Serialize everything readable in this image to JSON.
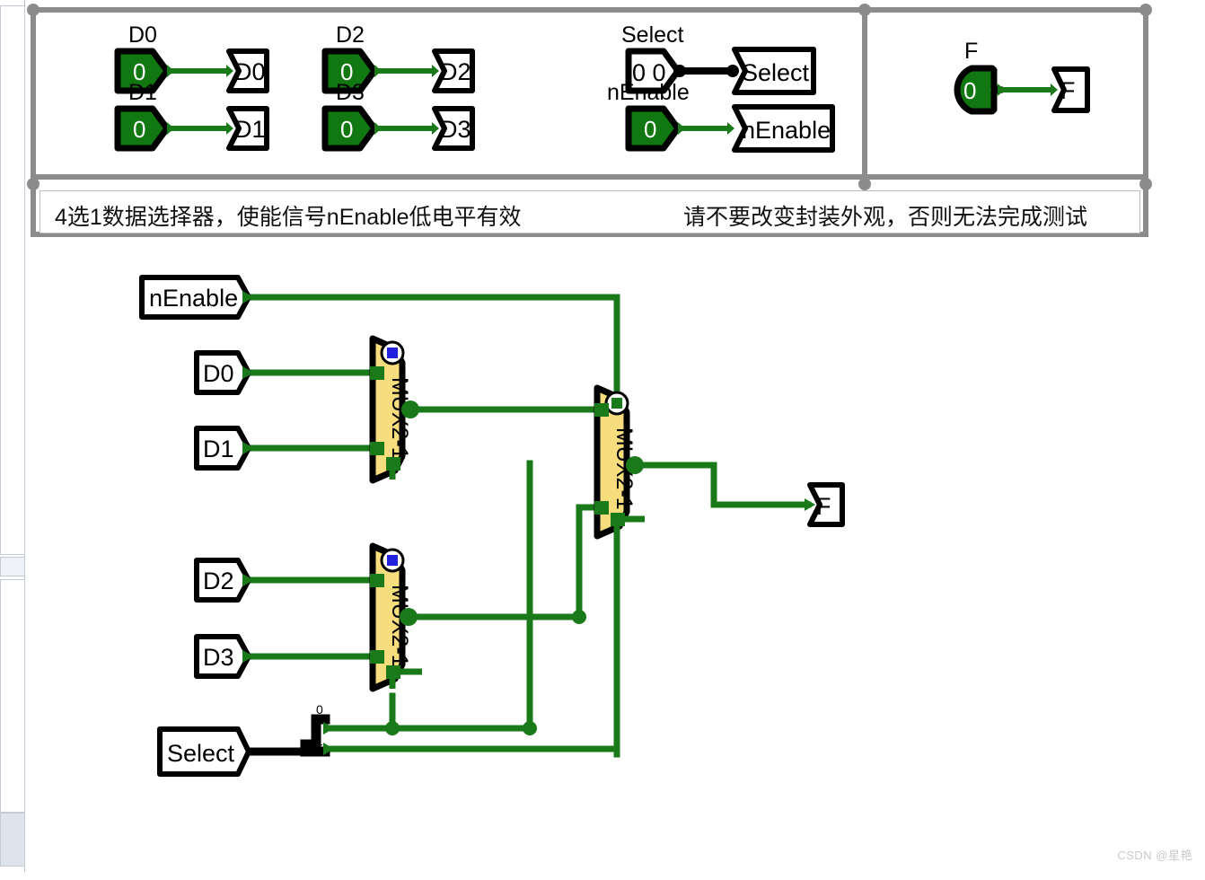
{
  "editor": {
    "description_left": "4选1数据选择器，使能信号nEnable低电平有效",
    "description_right": "请不要改变封装外观，否则无法完成测试",
    "watermark": "CSDN @星艳"
  },
  "appearance": {
    "inputs": [
      {
        "name": "D0",
        "label": "D0",
        "value": "0",
        "state": "off",
        "kind": "toggle"
      },
      {
        "name": "D1",
        "label": "D1",
        "value": "0",
        "state": "off",
        "kind": "toggle"
      },
      {
        "name": "D2",
        "label": "D2",
        "value": "0",
        "state": "off",
        "kind": "toggle"
      },
      {
        "name": "D3",
        "label": "D3",
        "value": "0",
        "state": "off",
        "kind": "toggle"
      },
      {
        "name": "Select",
        "label": "Select",
        "value": "0 0",
        "state": "unset",
        "kind": "bus-toggle"
      },
      {
        "name": "nEnable",
        "label": "nEnable",
        "value": "0",
        "state": "off",
        "kind": "toggle"
      }
    ],
    "outputs": [
      {
        "name": "F",
        "label": "F",
        "value": "0",
        "state": "off",
        "kind": "probe"
      }
    ]
  },
  "schematic": {
    "input_pins": [
      "nEnable",
      "D0",
      "D1",
      "D2",
      "D3",
      "Select"
    ],
    "output_pins": [
      "F"
    ],
    "components": [
      {
        "id": "mux-1",
        "label": "MUX2-1",
        "enable_state": "blue"
      },
      {
        "id": "mux-2",
        "label": "MUX2-1",
        "enable_state": "blue"
      },
      {
        "id": "mux-3",
        "label": "MUX2-1",
        "enable_state": "green"
      }
    ],
    "splitter": {
      "bits": [
        "0",
        "1"
      ]
    }
  },
  "colors": {
    "wire": "#1a7a1a",
    "bus": "#000000",
    "mux_fill": "#f7dd7d",
    "mux_stroke": "#000000",
    "probe_on": "#117711",
    "frame": "#8c8c8c",
    "enable_blue": "#2222dd",
    "enable_green": "#1a7a1a"
  }
}
